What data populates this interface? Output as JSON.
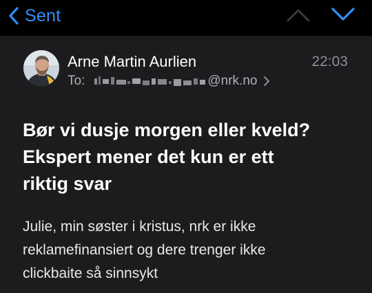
{
  "navbar": {
    "back_label": "Sent",
    "back_icon": "chevron-left-icon",
    "previous_icon": "chevron-up-icon",
    "next_icon": "chevron-down-icon",
    "accent_color": "#2f8ff7"
  },
  "message": {
    "sender": "Arne Martin Aurlien",
    "time": "22:03",
    "to_label": "To:",
    "to_domain": "@nrk.no",
    "to_chevron_icon": "chevron-right-icon",
    "subject_lines": [
      "Bør vi dusje morgen eller kveld?",
      "Ekspert mener det kun er ett",
      "riktig svar"
    ],
    "body_lines": [
      "Julie, min søster i kristus, nrk er ikke",
      "reklamefinansiert og dere trenger ikke",
      "clickbaite så sinnsykt"
    ]
  }
}
